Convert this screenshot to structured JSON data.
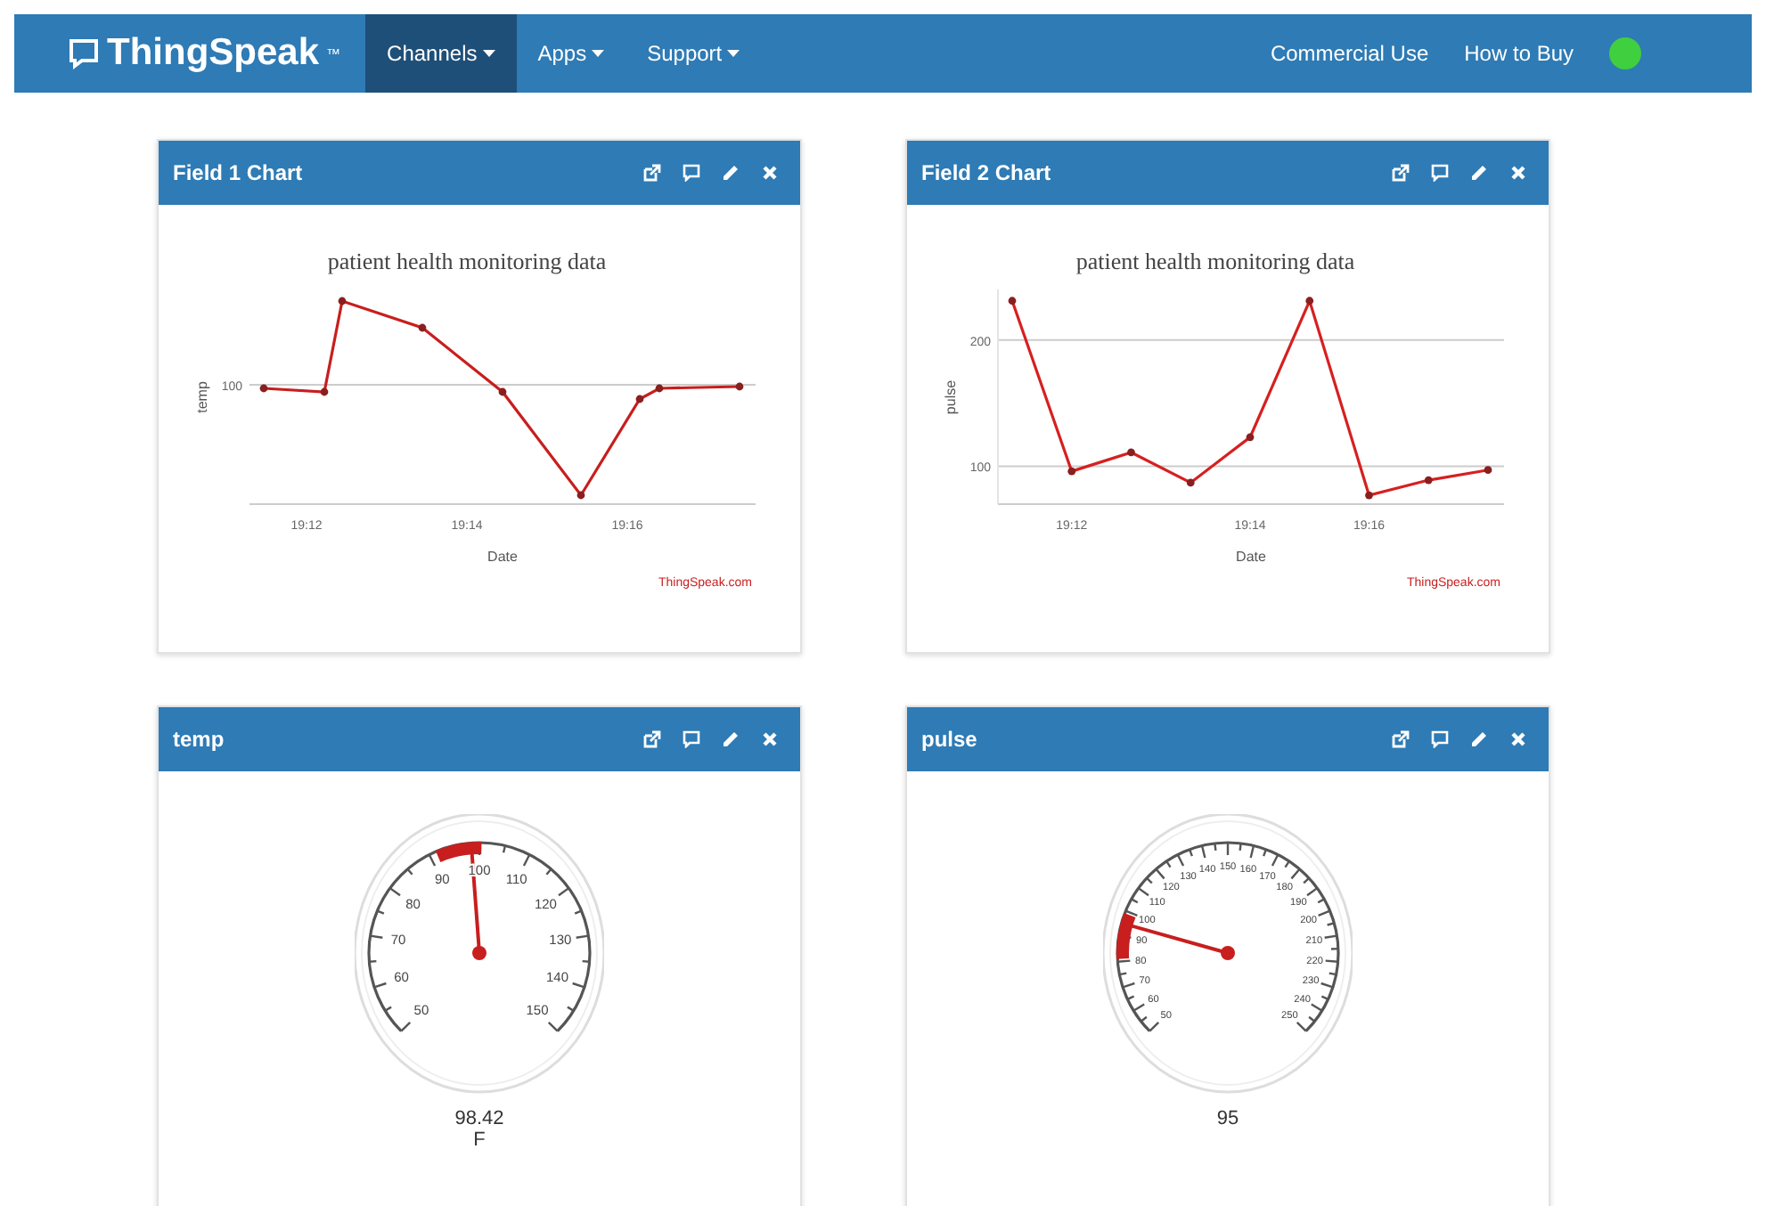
{
  "navbar": {
    "brand": "ThingSpeak",
    "brand_mark": "™",
    "menus": [
      {
        "label": "Channels",
        "selected": true
      },
      {
        "label": "Apps",
        "selected": false
      },
      {
        "label": "Support",
        "selected": false
      }
    ],
    "links": [
      "Commercial Use",
      "How to Buy"
    ]
  },
  "panels": [
    {
      "kind": "linechart_picture",
      "title": "Field 1 Chart",
      "chart": {
        "title": "patient health monitoring data",
        "ylabel": "temp",
        "ytick": "100",
        "xticks": [
          "19:12",
          "19:14",
          "19:16"
        ],
        "xlabel": "Date",
        "credits": "ThingSpeak.com"
      }
    },
    {
      "kind": "linechart",
      "title": "Field 2 Chart",
      "chart_data": {
        "type": "line",
        "title": "patient health monitoring data",
        "xlabel": "Date",
        "ylabel": "pulse",
        "categories": [
          null,
          "19:12",
          null,
          null,
          "19:14",
          null,
          "19:16",
          null,
          null
        ],
        "series": [
          {
            "color": "#d62020",
            "marker": true,
            "values": [
              231,
              96,
              111,
              87,
              123,
              231,
              77,
              89,
              97
            ]
          }
        ],
        "ylim": [
          70,
          240
        ],
        "yticks": [
          100,
          200
        ]
      },
      "credits": "ThingSpeak.com"
    },
    {
      "kind": "gauge",
      "title": "temp",
      "gauge": {
        "ticks": [
          "100",
          "90",
          "110",
          "80",
          "120",
          "70",
          "130",
          "60",
          "140",
          "50",
          "150"
        ],
        "reading": "98.42",
        "unit": "F"
      }
    },
    {
      "kind": "gauge",
      "title": "pulse",
      "gauge": {
        "ticks": [
          "140",
          "150",
          "160",
          "130",
          "170",
          "120",
          "180",
          "110",
          "190",
          "100",
          "200",
          "90",
          "210",
          "80",
          "220",
          "70",
          "230",
          "60",
          "240",
          "50",
          "250"
        ],
        "reading": "95"
      }
    }
  ]
}
